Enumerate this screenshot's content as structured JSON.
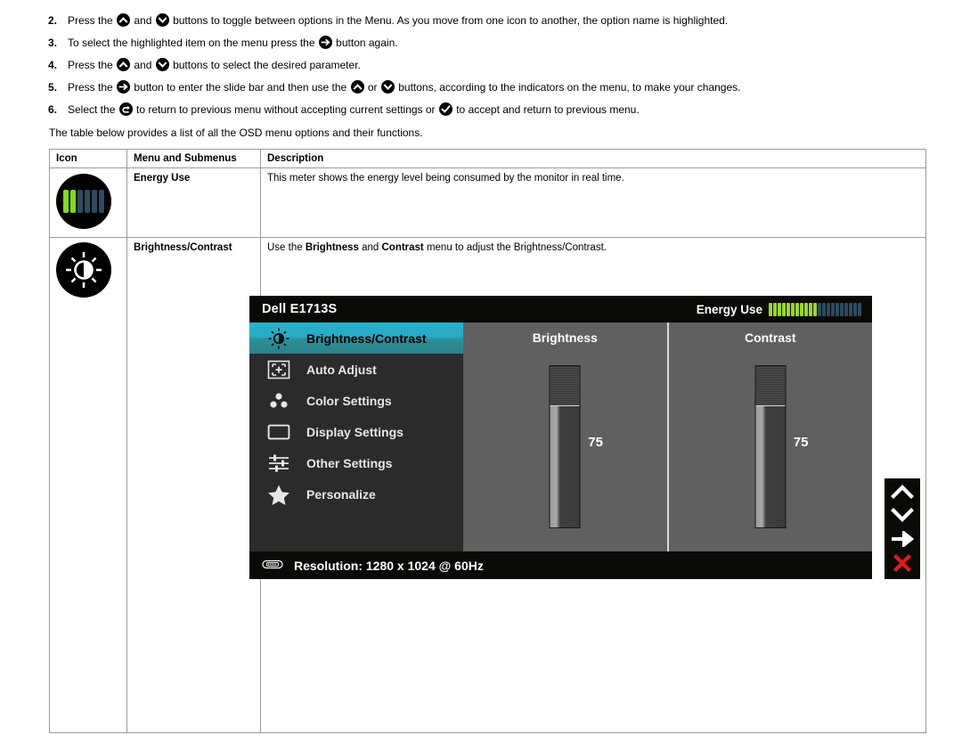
{
  "steps": [
    {
      "num": "2.",
      "parts": [
        {
          "t": "text",
          "v": "Press the "
        },
        {
          "t": "icon",
          "v": "chevron-up-key-icon"
        },
        {
          "t": "text",
          "v": " and "
        },
        {
          "t": "icon",
          "v": "chevron-down-key-icon"
        },
        {
          "t": "text",
          "v": " buttons to toggle between options in the Menu. As you move from one icon to another, the option name is highlighted."
        }
      ]
    },
    {
      "num": "3.",
      "parts": [
        {
          "t": "text",
          "v": "To select the highlighted item on the menu press the "
        },
        {
          "t": "icon",
          "v": "arrow-right-key-icon"
        },
        {
          "t": "text",
          "v": " button again."
        }
      ]
    },
    {
      "num": "4.",
      "parts": [
        {
          "t": "text",
          "v": "Press the "
        },
        {
          "t": "icon",
          "v": "chevron-up-key-icon"
        },
        {
          "t": "text",
          "v": " and "
        },
        {
          "t": "icon",
          "v": "chevron-down-key-icon"
        },
        {
          "t": "text",
          "v": " buttons to select the desired parameter."
        }
      ]
    },
    {
      "num": "5.",
      "parts": [
        {
          "t": "text",
          "v": "Press the "
        },
        {
          "t": "icon",
          "v": "arrow-right-key-icon"
        },
        {
          "t": "text",
          "v": " button to enter the slide bar and then use the "
        },
        {
          "t": "icon",
          "v": "chevron-up-key-icon"
        },
        {
          "t": "text",
          "v": " or "
        },
        {
          "t": "icon",
          "v": "chevron-down-key-icon"
        },
        {
          "t": "text",
          "v": " buttons, according to the indicators on the menu, to make your changes."
        }
      ]
    },
    {
      "num": "6.",
      "parts": [
        {
          "t": "text",
          "v": "Select the "
        },
        {
          "t": "icon",
          "v": "back-arrow-key-icon"
        },
        {
          "t": "text",
          "v": " to return to previous menu without accepting current settings or "
        },
        {
          "t": "icon",
          "v": "check-key-icon"
        },
        {
          "t": "text",
          "v": " to accept and return to previous menu."
        }
      ]
    }
  ],
  "intro_line": "The table below provides a list of all the OSD menu options and their functions.",
  "table": {
    "headers": [
      "Icon",
      "Menu and Submenus",
      "Description"
    ],
    "rows": [
      {
        "icon": "energy-use-icon",
        "menu": "Energy Use",
        "description_plain": "This meter shows the energy level being consumed by the monitor in real time."
      },
      {
        "icon": "brightness-contrast-icon",
        "menu": "Brightness/Contrast",
        "description_parts": [
          {
            "t": "text",
            "v": "Use the "
          },
          {
            "t": "bold",
            "v": "Brightness"
          },
          {
            "t": "text",
            "v": " and "
          },
          {
            "t": "bold",
            "v": "Contrast"
          },
          {
            "t": "text",
            "v": " menu to adjust the Brightness/Contrast."
          }
        ]
      }
    ]
  },
  "osd": {
    "model": "Dell E1713S",
    "energy_label": "Energy Use",
    "energy_bars_on": 11,
    "energy_bars_off": 10,
    "menu_items": [
      {
        "label": "Brightness/Contrast",
        "icon": "brightness-contrast-icon",
        "active": true
      },
      {
        "label": "Auto Adjust",
        "icon": "auto-adjust-icon",
        "active": false
      },
      {
        "label": "Color Settings",
        "icon": "color-settings-icon",
        "active": false
      },
      {
        "label": "Display Settings",
        "icon": "display-settings-icon",
        "active": false
      },
      {
        "label": "Other Settings",
        "icon": "other-settings-icon",
        "active": false
      },
      {
        "label": "Personalize",
        "icon": "personalize-star-icon",
        "active": false
      }
    ],
    "panes": [
      {
        "title": "Brightness",
        "value": "75",
        "fill_percent": 75
      },
      {
        "title": "Contrast",
        "value": "75",
        "fill_percent": 75
      }
    ],
    "resolution_text": "Resolution: 1280 x 1024 @ 60Hz",
    "resolution_icon": "vga-connector-icon"
  },
  "nav_buttons": [
    {
      "icon": "chevron-up-icon",
      "color": "#ffffff"
    },
    {
      "icon": "chevron-down-icon",
      "color": "#ffffff"
    },
    {
      "icon": "arrow-right-icon",
      "color": "#ffffff"
    },
    {
      "icon": "close-x-icon",
      "color": "#e01b1b"
    }
  ],
  "colors": {
    "highlight_teal": "#2ab0cc",
    "energy_green": "#9bd629",
    "energy_dark": "#2c4a60",
    "close_red": "#e01b1b",
    "osd_background": "#3b3b3b",
    "osd_titlebar": "#0b0905"
  }
}
